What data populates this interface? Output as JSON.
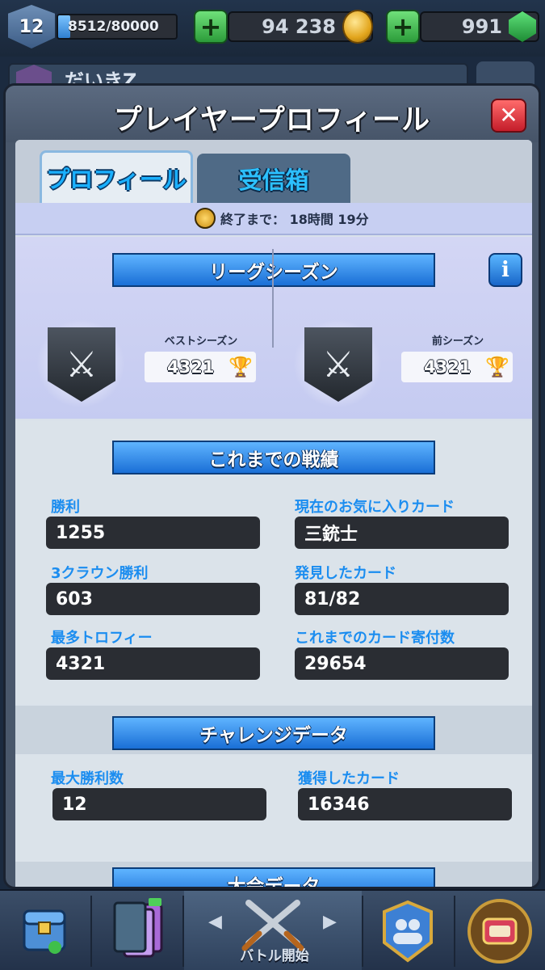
{
  "top_bar": {
    "level": "12",
    "xp_text": "8512/80000",
    "xp_progress": 0.106,
    "gold": "94 238",
    "gems": "991",
    "add_gold_icon": "plus-icon",
    "add_gems_icon": "plus-icon",
    "colors": {
      "plus": "#3aa845",
      "gold": "#e2a51c",
      "gem": "#2fa84a"
    }
  },
  "background": {
    "clan_name": "だいきZ"
  },
  "modal": {
    "title": "プレイヤープロフィール",
    "close_icon": "close-x-icon",
    "tabs": [
      {
        "label": "プロフィール",
        "active": true
      },
      {
        "label": "受信箱",
        "active": false
      }
    ],
    "timer": "終了まで： 18時間 19分",
    "league": {
      "title": "リーグシーズン",
      "info_icon": "info-icon",
      "best_season_label": "ベストシーズン",
      "best_season_trophies": "4321",
      "previous_season_label": "前シーズン",
      "previous_season_trophies": "4321"
    },
    "stats": {
      "title": "これまでの戦績",
      "items": [
        {
          "label": "勝利",
          "value": "1255"
        },
        {
          "label": "現在のお気に入りカード",
          "value": "三銃士"
        },
        {
          "label": "3クラウン勝利",
          "value": "603"
        },
        {
          "label": "発見したカード",
          "value": "81/82"
        },
        {
          "label": "最多トロフィー",
          "value": "4321"
        },
        {
          "label": "これまでのカード寄付数",
          "value": "29654"
        }
      ]
    },
    "challenge": {
      "title": "チャレンジデータ",
      "items": [
        {
          "label": "最大勝利数",
          "value": "12"
        },
        {
          "label": "獲得したカード",
          "value": "16346"
        }
      ]
    },
    "tournament": {
      "title": "大会データ"
    }
  },
  "bottom_nav": {
    "battle_label": "バトル開始",
    "items": [
      "shop-icon",
      "cards-icon",
      "battle-icon",
      "social-icon",
      "tournaments-icon"
    ]
  }
}
